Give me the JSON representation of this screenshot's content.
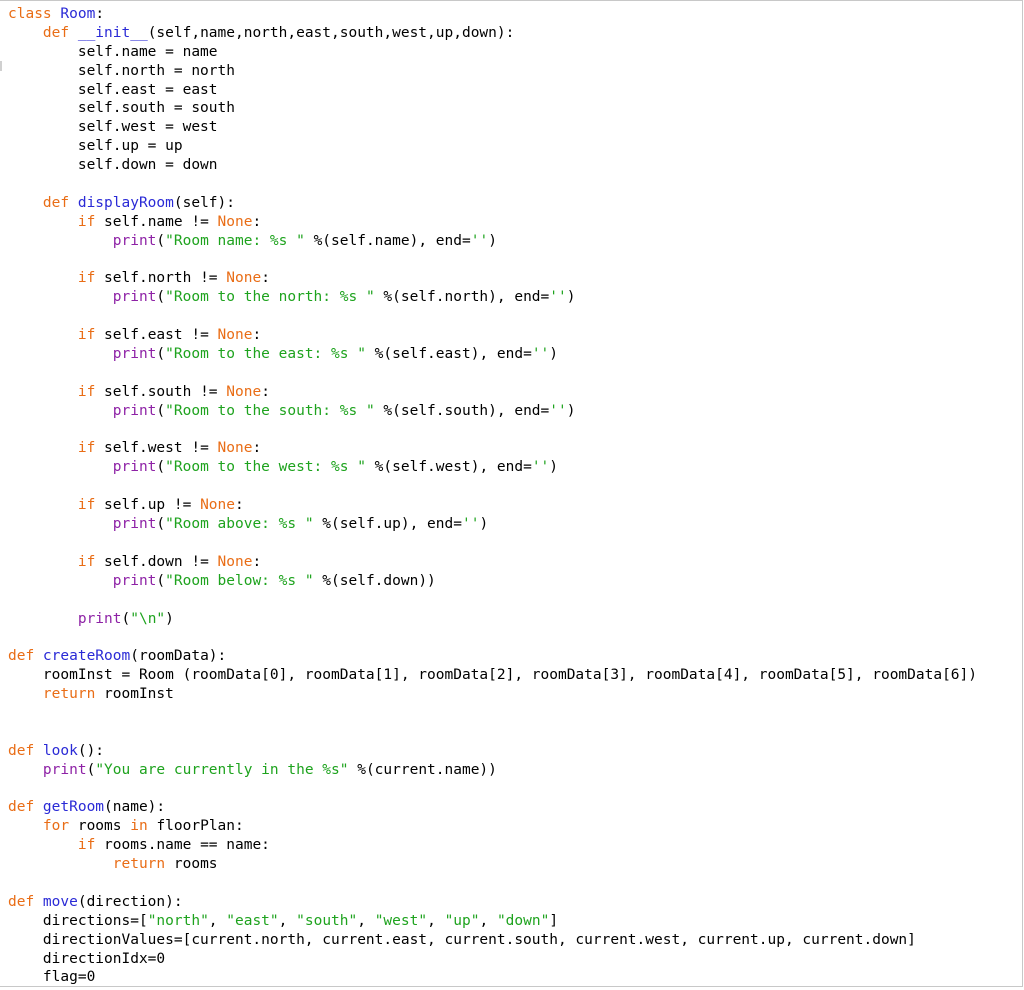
{
  "editor": {
    "language": "python",
    "colors": {
      "keyword": "#e96d16",
      "function_name": "#2a2ad6",
      "builtin": "#8e22a6",
      "string": "#1ea31e",
      "plain": "#000000"
    },
    "lines": [
      [
        [
          "kw",
          "class "
        ],
        [
          "fn",
          "Room"
        ],
        [
          "n",
          ":"
        ]
      ],
      [
        [
          "n",
          "    "
        ],
        [
          "kw",
          "def "
        ],
        [
          "fn",
          "__init__"
        ],
        [
          "n",
          "(self,name,north,east,south,west,up,down):"
        ]
      ],
      [
        [
          "n",
          "        self.name = name"
        ]
      ],
      [
        [
          "n",
          "        self.north = north"
        ]
      ],
      [
        [
          "n",
          "        self.east = east"
        ]
      ],
      [
        [
          "n",
          "        self.south = south"
        ]
      ],
      [
        [
          "n",
          "        self.west = west"
        ]
      ],
      [
        [
          "n",
          "        self.up = up"
        ]
      ],
      [
        [
          "n",
          "        self.down = down"
        ]
      ],
      [],
      [
        [
          "n",
          "    "
        ],
        [
          "kw",
          "def "
        ],
        [
          "fn",
          "displayRoom"
        ],
        [
          "n",
          "(self):"
        ]
      ],
      [
        [
          "n",
          "        "
        ],
        [
          "kw",
          "if "
        ],
        [
          "n",
          "self.name != "
        ],
        [
          "kw",
          "None"
        ],
        [
          "n",
          ":"
        ]
      ],
      [
        [
          "n",
          "            "
        ],
        [
          "bi",
          "print"
        ],
        [
          "n",
          "("
        ],
        [
          "str",
          "\"Room name: %s \""
        ],
        [
          "n",
          " %(self.name), end="
        ],
        [
          "str",
          "''"
        ],
        [
          "n",
          ")"
        ]
      ],
      [],
      [
        [
          "n",
          "        "
        ],
        [
          "kw",
          "if "
        ],
        [
          "n",
          "self.north != "
        ],
        [
          "kw",
          "None"
        ],
        [
          "n",
          ":"
        ]
      ],
      [
        [
          "n",
          "            "
        ],
        [
          "bi",
          "print"
        ],
        [
          "n",
          "("
        ],
        [
          "str",
          "\"Room to the north: %s \""
        ],
        [
          "n",
          " %(self.north), end="
        ],
        [
          "str",
          "''"
        ],
        [
          "n",
          ")"
        ]
      ],
      [],
      [
        [
          "n",
          "        "
        ],
        [
          "kw",
          "if "
        ],
        [
          "n",
          "self.east != "
        ],
        [
          "kw",
          "None"
        ],
        [
          "n",
          ":"
        ]
      ],
      [
        [
          "n",
          "            "
        ],
        [
          "bi",
          "print"
        ],
        [
          "n",
          "("
        ],
        [
          "str",
          "\"Room to the east: %s \""
        ],
        [
          "n",
          " %(self.east), end="
        ],
        [
          "str",
          "''"
        ],
        [
          "n",
          ")"
        ]
      ],
      [],
      [
        [
          "n",
          "        "
        ],
        [
          "kw",
          "if "
        ],
        [
          "n",
          "self.south != "
        ],
        [
          "kw",
          "None"
        ],
        [
          "n",
          ":"
        ]
      ],
      [
        [
          "n",
          "            "
        ],
        [
          "bi",
          "print"
        ],
        [
          "n",
          "("
        ],
        [
          "str",
          "\"Room to the south: %s \""
        ],
        [
          "n",
          " %(self.south), end="
        ],
        [
          "str",
          "''"
        ],
        [
          "n",
          ")"
        ]
      ],
      [],
      [
        [
          "n",
          "        "
        ],
        [
          "kw",
          "if "
        ],
        [
          "n",
          "self.west != "
        ],
        [
          "kw",
          "None"
        ],
        [
          "n",
          ":"
        ]
      ],
      [
        [
          "n",
          "            "
        ],
        [
          "bi",
          "print"
        ],
        [
          "n",
          "("
        ],
        [
          "str",
          "\"Room to the west: %s \""
        ],
        [
          "n",
          " %(self.west), end="
        ],
        [
          "str",
          "''"
        ],
        [
          "n",
          ")"
        ]
      ],
      [],
      [
        [
          "n",
          "        "
        ],
        [
          "kw",
          "if "
        ],
        [
          "n",
          "self.up != "
        ],
        [
          "kw",
          "None"
        ],
        [
          "n",
          ":"
        ]
      ],
      [
        [
          "n",
          "            "
        ],
        [
          "bi",
          "print"
        ],
        [
          "n",
          "("
        ],
        [
          "str",
          "\"Room above: %s \""
        ],
        [
          "n",
          " %(self.up), end="
        ],
        [
          "str",
          "''"
        ],
        [
          "n",
          ")"
        ]
      ],
      [],
      [
        [
          "n",
          "        "
        ],
        [
          "kw",
          "if "
        ],
        [
          "n",
          "self.down != "
        ],
        [
          "kw",
          "None"
        ],
        [
          "n",
          ":"
        ]
      ],
      [
        [
          "n",
          "            "
        ],
        [
          "bi",
          "print"
        ],
        [
          "n",
          "("
        ],
        [
          "str",
          "\"Room below: %s \""
        ],
        [
          "n",
          " %(self.down))"
        ]
      ],
      [],
      [
        [
          "n",
          "        "
        ],
        [
          "bi",
          "print"
        ],
        [
          "n",
          "("
        ],
        [
          "str",
          "\"\\n\""
        ],
        [
          "n",
          ")"
        ]
      ],
      [],
      [
        [
          "kw",
          "def "
        ],
        [
          "fn",
          "createRoom"
        ],
        [
          "n",
          "(roomData):"
        ]
      ],
      [
        [
          "n",
          "    roomInst = Room (roomData[0], roomData[1], roomData[2], roomData[3], roomData[4], roomData[5], roomData[6])"
        ]
      ],
      [
        [
          "n",
          "    "
        ],
        [
          "kw",
          "return "
        ],
        [
          "n",
          "roomInst"
        ]
      ],
      [],
      [],
      [
        [
          "kw",
          "def "
        ],
        [
          "fn",
          "look"
        ],
        [
          "n",
          "():"
        ]
      ],
      [
        [
          "n",
          "    "
        ],
        [
          "bi",
          "print"
        ],
        [
          "n",
          "("
        ],
        [
          "str",
          "\"You are currently in the %s\""
        ],
        [
          "n",
          " %(current.name))"
        ]
      ],
      [],
      [
        [
          "kw",
          "def "
        ],
        [
          "fn",
          "getRoom"
        ],
        [
          "n",
          "(name):"
        ]
      ],
      [
        [
          "n",
          "    "
        ],
        [
          "kw",
          "for "
        ],
        [
          "n",
          "rooms "
        ],
        [
          "kw",
          "in "
        ],
        [
          "n",
          "floorPlan:"
        ]
      ],
      [
        [
          "n",
          "        "
        ],
        [
          "kw",
          "if "
        ],
        [
          "n",
          "rooms.name == name:"
        ]
      ],
      [
        [
          "n",
          "            "
        ],
        [
          "kw",
          "return "
        ],
        [
          "n",
          "rooms"
        ]
      ],
      [],
      [
        [
          "kw",
          "def "
        ],
        [
          "fn",
          "move"
        ],
        [
          "n",
          "(direction):"
        ]
      ],
      [
        [
          "n",
          "    directions=["
        ],
        [
          "str",
          "\"north\""
        ],
        [
          "n",
          ", "
        ],
        [
          "str",
          "\"east\""
        ],
        [
          "n",
          ", "
        ],
        [
          "str",
          "\"south\""
        ],
        [
          "n",
          ", "
        ],
        [
          "str",
          "\"west\""
        ],
        [
          "n",
          ", "
        ],
        [
          "str",
          "\"up\""
        ],
        [
          "n",
          ", "
        ],
        [
          "str",
          "\"down\""
        ],
        [
          "n",
          "]"
        ]
      ],
      [
        [
          "n",
          "    directionValues=[current.north, current.east, current.south, current.west, current.up, current.down]"
        ]
      ],
      [
        [
          "n",
          "    directionIdx=0"
        ]
      ],
      [
        [
          "n",
          "    flag=0"
        ]
      ]
    ]
  }
}
